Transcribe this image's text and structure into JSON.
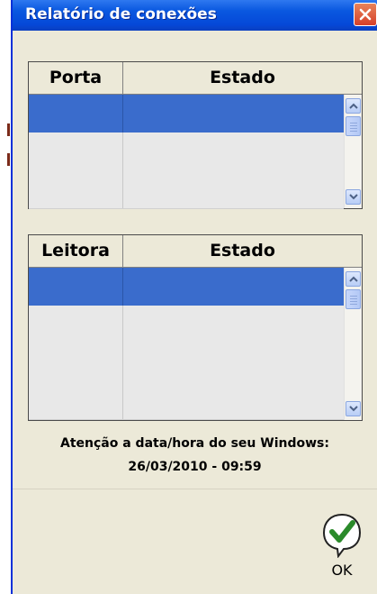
{
  "window": {
    "title": "Relatório de conexões"
  },
  "ports_table": {
    "columns": [
      "Porta",
      "Estado"
    ],
    "rows": [
      {
        "porta": "",
        "estado": "",
        "selected": true
      },
      {
        "porta": "",
        "estado": "",
        "selected": false
      },
      {
        "porta": "",
        "estado": "",
        "selected": false
      }
    ]
  },
  "readers_table": {
    "columns": [
      "Leitora",
      "Estado"
    ],
    "rows": [
      {
        "leitora": "",
        "estado": "",
        "selected": true
      },
      {
        "leitora": "",
        "estado": "",
        "selected": false
      },
      {
        "leitora": "",
        "estado": "",
        "selected": false
      },
      {
        "leitora": "",
        "estado": "",
        "selected": false
      }
    ]
  },
  "notice": {
    "line1": "Atenção a data/hora do seu Windows:",
    "line2": "26/03/2010 - 09:59"
  },
  "footer": {
    "ok_label": "OK"
  },
  "colors": {
    "titlebar": "#0548d8",
    "selection": "#3a6ccc",
    "window_bg": "#ece9d8",
    "close": "#d6402a",
    "ok_check": "#2a8a2a"
  },
  "icons": {
    "close": "close-icon",
    "scroll_up": "arrow-up-icon",
    "scroll_down": "arrow-down-icon",
    "ok": "checkmark-bubble-icon"
  }
}
